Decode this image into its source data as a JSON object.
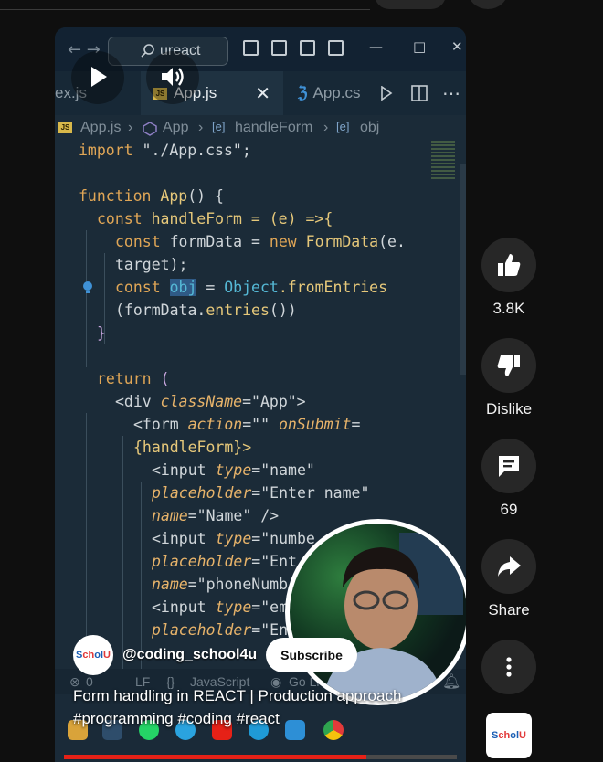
{
  "editor": {
    "search_text": "ureact",
    "tabs": [
      {
        "label": "ex.js"
      },
      {
        "label": "App.js"
      },
      {
        "label": "App.cs"
      }
    ],
    "breadcrumb": [
      "App.js",
      "App",
      "handleForm",
      "obj"
    ],
    "status": {
      "errors": "0",
      "eol": "LF",
      "braces": "{}",
      "language": "JavaScript",
      "golive": "Go Live"
    }
  },
  "code": {
    "l1": {
      "a": "import ",
      "b": "\"./App.css\"",
      "c": ";"
    },
    "l3": {
      "a": "function ",
      "b": "App",
      "c": "() {"
    },
    "l4": {
      "a": "const ",
      "b": "handleForm = (e) =>{"
    },
    "l5": {
      "a": "const ",
      "b": "formData = ",
      "c": "new ",
      "d": "FormData",
      "e": "(e."
    },
    "l6": {
      "a": "target);"
    },
    "l7": {
      "a": "const ",
      "b": "obj",
      "c": " = ",
      "d": "Object",
      "e": ".fromEntries"
    },
    "l8": {
      "a": "(formData.",
      "b": "entries",
      "c": "())"
    },
    "l9": {
      "a": "}"
    },
    "l11": {
      "a": "return ",
      "b": "("
    },
    "l12": {
      "a": "<div ",
      "b": "className",
      "c": "=\"App\">"
    },
    "l13": {
      "a": "<form ",
      "b": "action",
      "c": "=\"\" ",
      "d": "onSubmit",
      "e": "="
    },
    "l14": {
      "a": "{handleForm}>"
    },
    "l15": {
      "a": "<input ",
      "b": "type",
      "c": "=\"name\""
    },
    "l16": {
      "a": "placeholder",
      "b": "=\"Enter name\""
    },
    "l17": {
      "a": "name",
      "b": "=\"Name\" />"
    },
    "l18": {
      "a": "<input ",
      "b": "type",
      "c": "=\"numbe"
    },
    "l19": {
      "a": "placeholder",
      "b": "=\"Ent"
    },
    "l20": {
      "a": "name",
      "b": "=\"phoneNumb"
    },
    "l21": {
      "a": "<input ",
      "b": "type",
      "c": "=\"em"
    },
    "l22": {
      "a": "placeholder",
      "b": "=\"En"
    }
  },
  "video": {
    "progress_fraction": 0.77,
    "channel_handle": "@coding_school4u",
    "subscribe_label": "Subscribe",
    "title_line1": "Form handling in REACT | Production approach",
    "title_line2": "#programming #coding #react",
    "avatar_text_a": "S",
    "avatar_text_b": "ch",
    "avatar_text_c": "ol",
    "avatar_text_d": "U"
  },
  "actions": {
    "like_count": "3.8K",
    "dislike_label": "Dislike",
    "comment_count": "69",
    "share_label": "Share"
  },
  "colors": {
    "progress": "#e62117",
    "accent_highlight": "#2f5a86"
  }
}
